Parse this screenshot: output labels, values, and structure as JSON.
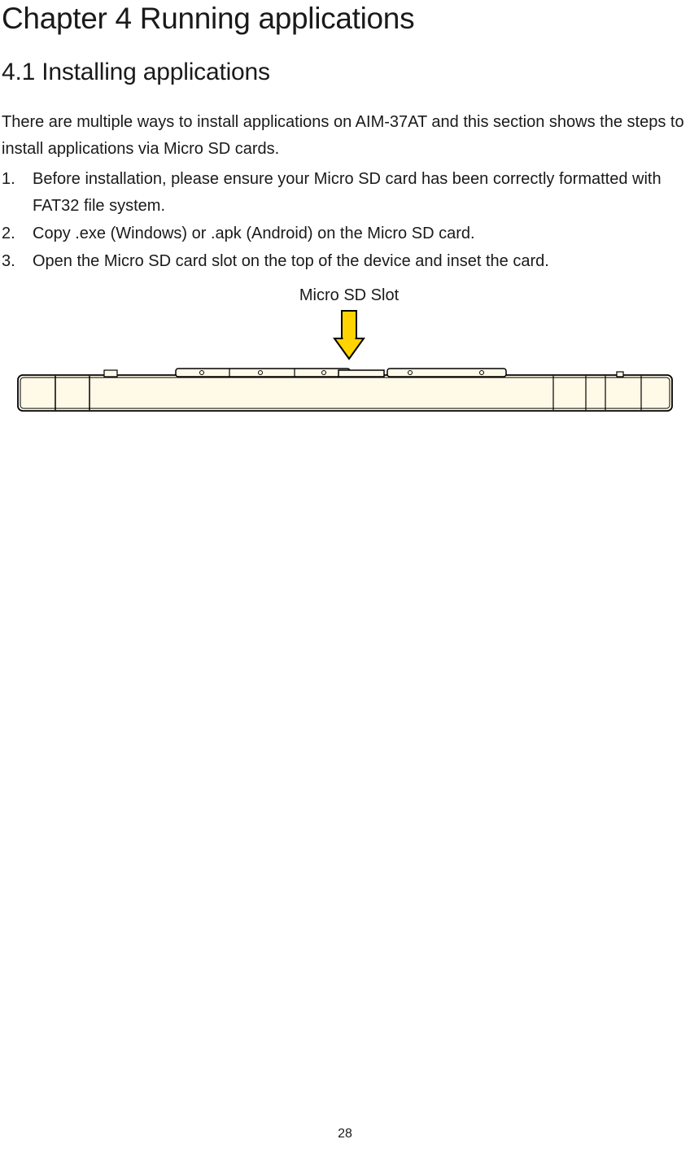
{
  "chapter": {
    "title": "Chapter 4 Running applications"
  },
  "section": {
    "title": "4.1 Installing applications",
    "intro": "There are multiple ways to install applications on AIM-37AT and this section shows the steps to install applications via Micro SD cards.",
    "steps": [
      "Before installation, please ensure your Micro SD card has been correctly formatted with FAT32 file system.",
      "Copy .exe (Windows) or .apk (Android) on the Micro SD card.",
      "Open the Micro SD card slot on the top of the device and inset the card."
    ]
  },
  "figure": {
    "caption": "Micro SD Slot"
  },
  "page_number": "28"
}
